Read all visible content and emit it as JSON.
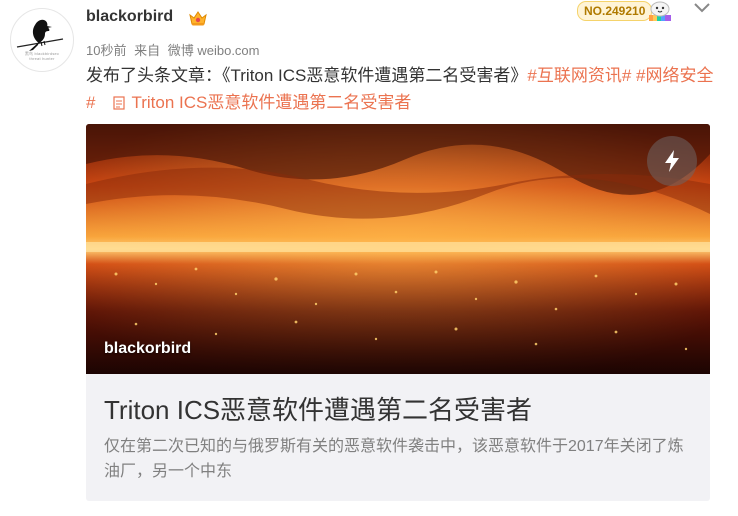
{
  "user": {
    "avatar_icon": "blackbird-icon",
    "avatar_tagline_1": "黑鸟 blackbirdsec",
    "avatar_tagline_2": "threat hunter",
    "name": "blackorbird",
    "vip_icon": "vip-crown-icon"
  },
  "member": {
    "number": "NO.249210",
    "icon": "member-mascot-icon"
  },
  "meta": {
    "time": "10秒前",
    "source_prefix": "来自",
    "source": "微博 weibo.com"
  },
  "post": {
    "text": "发布了头条文章：《Triton ICS恶意软件遭遇第二名受害者》",
    "hashtags": [
      "#互联网资讯#",
      "#网络安全#"
    ],
    "article_link": "Triton ICS恶意软件遭遇第二名受害者"
  },
  "card": {
    "image_caption": "blackorbird",
    "title": "Triton ICS恶意软件遭遇第二名受害者",
    "summary": "仅在第二次已知的与俄罗斯有关的恶意软件袭击中，该恶意软件于2017年关闭了炼油厂，另一个中东"
  },
  "colors": {
    "accent": "#eb7350",
    "muted": "#808080",
    "card_bg": "#f2f2f5"
  }
}
